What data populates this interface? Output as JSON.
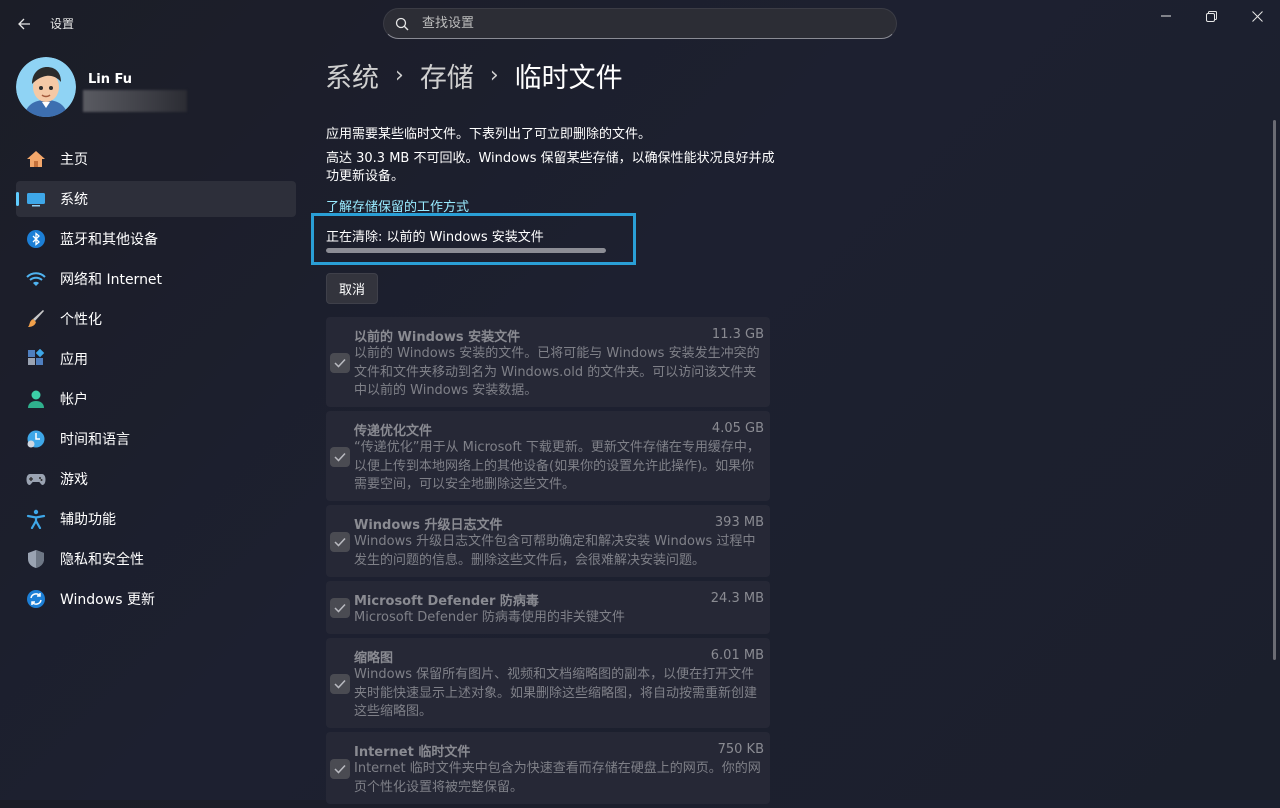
{
  "window": {
    "title": "设置",
    "controls": [
      "minimize-icon",
      "restore-icon",
      "close-icon"
    ]
  },
  "search": {
    "placeholder": "查找设置"
  },
  "user": {
    "name": "Lin Fu"
  },
  "nav": {
    "items": [
      {
        "label": "主页",
        "icon": "home-icon",
        "selected": false
      },
      {
        "label": "系统",
        "icon": "system-icon",
        "selected": true
      },
      {
        "label": "蓝牙和其他设备",
        "icon": "bluetooth-icon",
        "selected": false
      },
      {
        "label": "网络和 Internet",
        "icon": "wifi-icon",
        "selected": false
      },
      {
        "label": "个性化",
        "icon": "brush-icon",
        "selected": false
      },
      {
        "label": "应用",
        "icon": "apps-icon",
        "selected": false
      },
      {
        "label": "帐户",
        "icon": "account-icon",
        "selected": false
      },
      {
        "label": "时间和语言",
        "icon": "time-language-icon",
        "selected": false
      },
      {
        "label": "游戏",
        "icon": "gaming-icon",
        "selected": false
      },
      {
        "label": "辅助功能",
        "icon": "accessibility-icon",
        "selected": false
      },
      {
        "label": "隐私和安全性",
        "icon": "shield-icon",
        "selected": false
      },
      {
        "label": "Windows 更新",
        "icon": "update-icon",
        "selected": false
      }
    ]
  },
  "breadcrumb": {
    "items": [
      "系统",
      "存储",
      "临时文件"
    ],
    "separator": "›"
  },
  "main": {
    "desc1": "应用需要某些临时文件。下表列出了可立即删除的文件。",
    "desc2": "高达 30.3 MB 不可回收。Windows 保留某些存储，以确保性能状况良好并成功更新设备。",
    "learn_link": "了解存储保留的工作方式",
    "progress_label": "正在清除: 以前的 Windows 安装文件",
    "progress_fraction": 1.0,
    "cancel_label": "取消"
  },
  "files": [
    {
      "name": "以前的 Windows 安装文件",
      "size": "11.3 GB",
      "checked": true,
      "description": "以前的 Windows 安装的文件。已将可能与 Windows 安装发生冲突的文件和文件夹移动到名为 Windows.old 的文件夹。可以访问该文件夹中以前的 Windows 安装数据。"
    },
    {
      "name": "传递优化文件",
      "size": "4.05 GB",
      "checked": true,
      "description": "“传递优化”用于从 Microsoft 下载更新。更新文件存储在专用缓存中，以便上传到本地网络上的其他设备(如果你的设置允许此操作)。如果你需要空间，可以安全地删除这些文件。"
    },
    {
      "name": "Windows 升级日志文件",
      "size": "393 MB",
      "checked": true,
      "description": "Windows 升级日志文件包含可帮助确定和解决安装 Windows 过程中发生的问题的信息。删除这些文件后，会很难解决安装问题。"
    },
    {
      "name": "Microsoft Defender 防病毒",
      "size": "24.3 MB",
      "checked": true,
      "description": "Microsoft Defender 防病毒使用的非关键文件"
    },
    {
      "name": "缩略图",
      "size": "6.01 MB",
      "checked": true,
      "description": "Windows 保留所有图片、视频和文档缩略图的副本，以便在打开文件夹时能快速显示上述对象。如果删除这些缩略图，将自动按需重新创建这些缩略图。"
    },
    {
      "name": "Internet 临时文件",
      "size": "750 KB",
      "checked": true,
      "description": "Internet 临时文件夹中包含为快速查看而存储在硬盘上的网页。你的网页个性化设置将被完整保留。"
    }
  ],
  "colors": {
    "accent": "#60cdff",
    "link": "#99ebff",
    "highlight_box": "#2a9fd6"
  }
}
